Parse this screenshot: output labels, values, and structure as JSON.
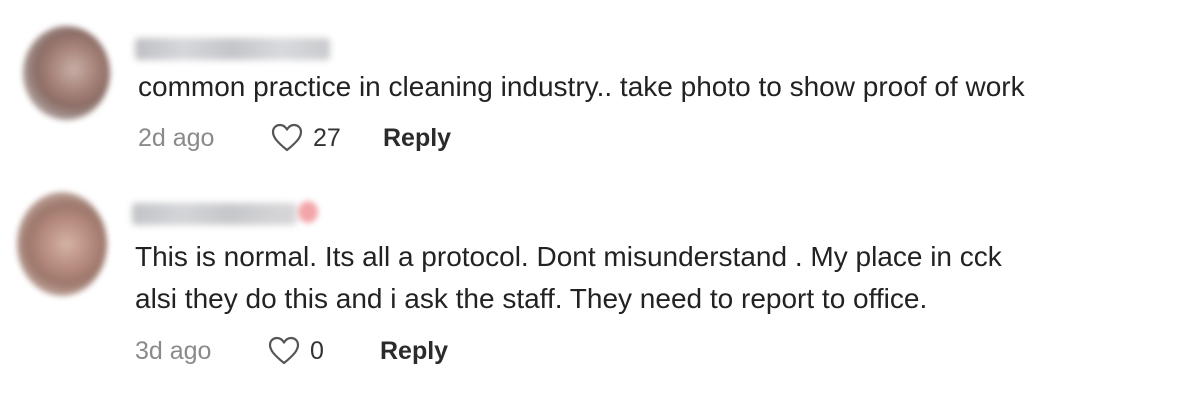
{
  "comments": [
    {
      "avatar_icon": "avatar-image",
      "text_lines": [
        "common practice in cleaning industry.. take photo to show proof of work"
      ],
      "time": "2d ago",
      "like_icon": "heart-outline-icon",
      "likes": "27",
      "reply_label": "Reply"
    },
    {
      "avatar_icon": "avatar-image",
      "text_lines": [
        "This is normal. Its all a protocol. Dont misunderstand . My place in cck",
        "alsi they do this and i ask the staff. They need to report to office."
      ],
      "time": "3d ago",
      "like_icon": "heart-outline-icon",
      "likes": "0",
      "reply_label": "Reply"
    }
  ],
  "colors": {
    "text": "#222222",
    "meta_text": "#8a8a8a",
    "heart_outline": "#555555",
    "background": "#ffffff"
  }
}
